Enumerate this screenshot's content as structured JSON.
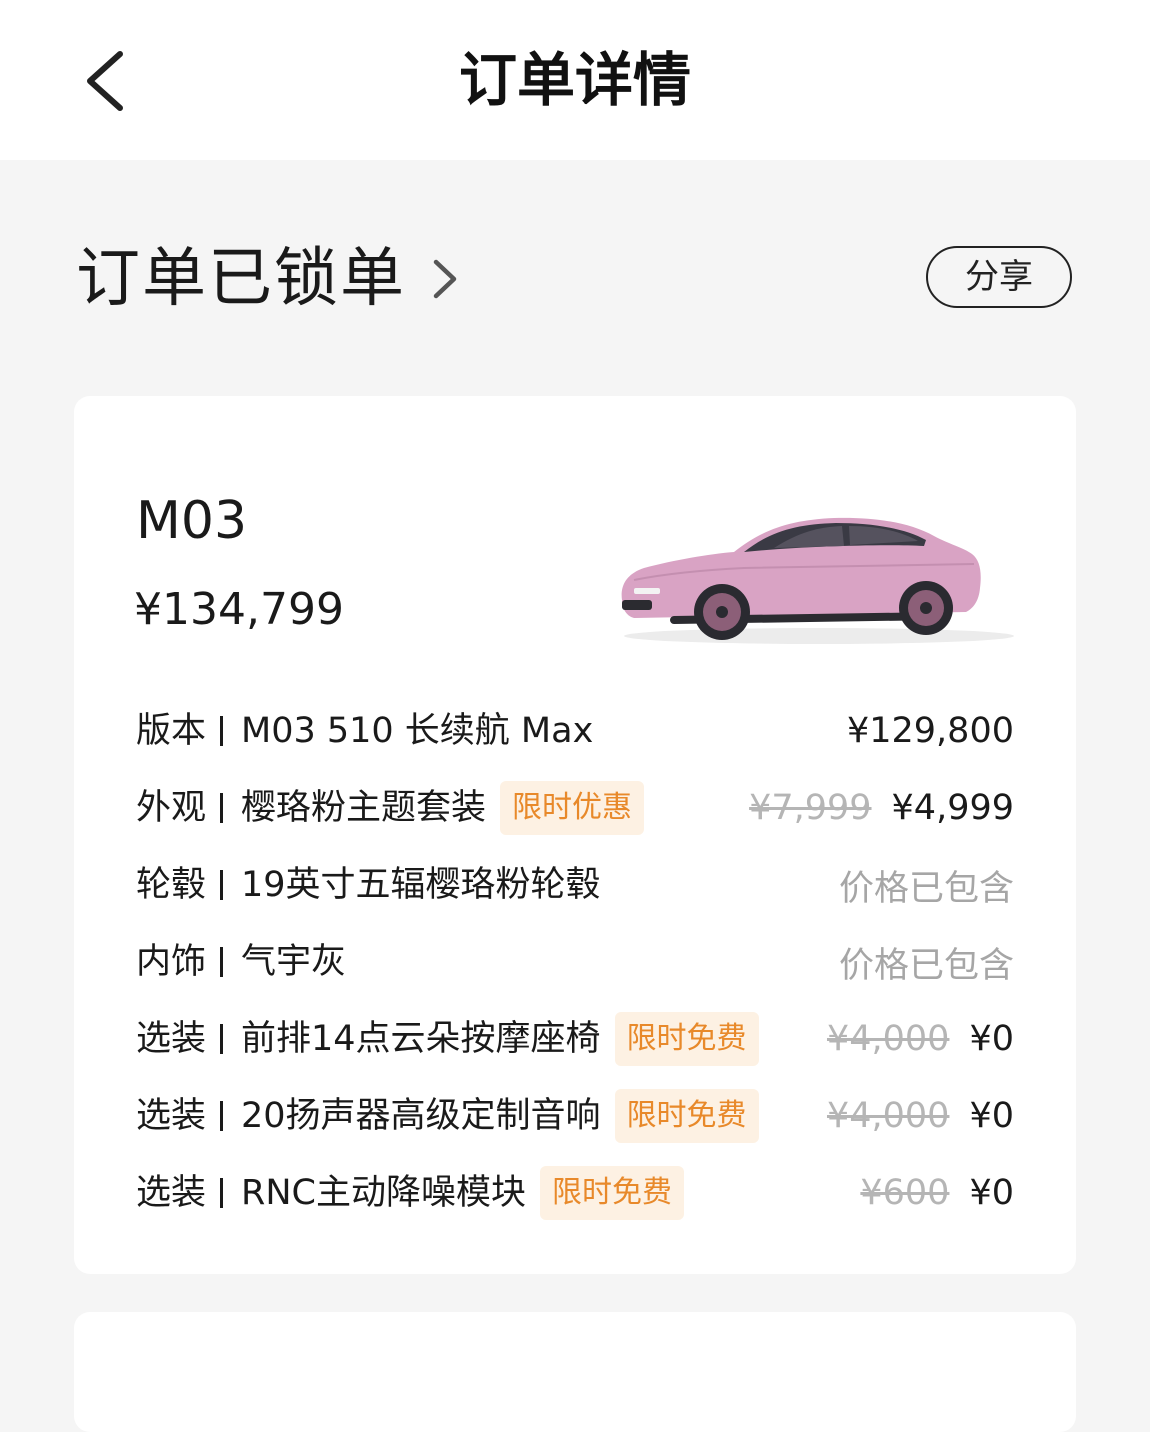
{
  "header": {
    "title": "订单详情"
  },
  "status": {
    "text": "订单已锁单",
    "share_label": "分享"
  },
  "car": {
    "model": "M03",
    "price": "¥134,799"
  },
  "rows": [
    {
      "category": "版本",
      "item": "M03 510 长续航 Max",
      "tag": "",
      "original_price": "",
      "price": "¥129,800"
    },
    {
      "category": "外观",
      "item": "樱珞粉主题套装",
      "tag": "限时优惠",
      "original_price": "¥7,999",
      "price": "¥4,999"
    },
    {
      "category": "轮毂",
      "item": "19英寸五辐樱珞粉轮毂",
      "tag": "",
      "original_price": "",
      "price": "价格已包含"
    },
    {
      "category": "内饰",
      "item": "气宇灰",
      "tag": "",
      "original_price": "",
      "price": "价格已包含"
    },
    {
      "category": "选装",
      "item": "前排14点云朵按摩座椅",
      "tag": "限时免费",
      "original_price": "¥4,000",
      "price": "¥0"
    },
    {
      "category": "选装",
      "item": "20扬声器高级定制音响",
      "tag": "限时免费",
      "original_price": "¥4,000",
      "price": "¥0"
    },
    {
      "category": "选装",
      "item": "RNC主动降噪模块",
      "tag": "限时免费",
      "original_price": "¥600",
      "price": "¥0"
    }
  ],
  "colors": {
    "page_background": "#f5f5f5",
    "tag_text": "#e8892a",
    "tag_background": "#fdf1e3",
    "car_body": "#d9a3c4"
  },
  "icons": {
    "back": "chevron-left-icon",
    "status_chevron": "chevron-right-icon"
  }
}
